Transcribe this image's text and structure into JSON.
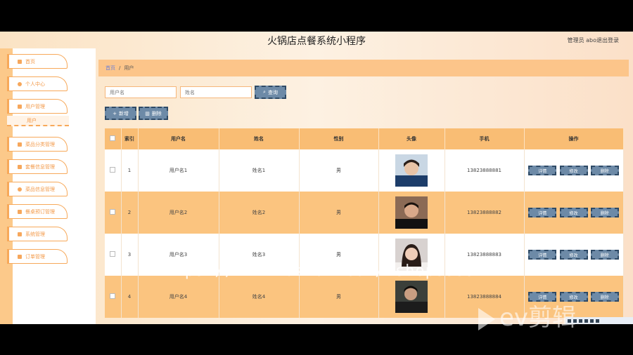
{
  "header": {
    "title": "火锅店点餐系统小程序",
    "user": "管理员 abo",
    "logout": "退出登录"
  },
  "sidebar": {
    "items": [
      {
        "label": "首页",
        "icon": "home-icon"
      },
      {
        "label": "个人中心",
        "icon": "person-icon"
      },
      {
        "label": "用户管理",
        "icon": "flag-icon"
      },
      {
        "label": "菜品分类管理",
        "icon": "flag-icon"
      },
      {
        "label": "套餐信息管理",
        "icon": "grid-icon"
      },
      {
        "label": "菜品信息管理",
        "icon": "gear-icon"
      },
      {
        "label": "餐桌预订管理",
        "icon": "flag-icon"
      },
      {
        "label": "系统管理",
        "icon": "grid-icon"
      },
      {
        "label": "订单管理",
        "icon": "grid-icon"
      }
    ],
    "subitem": "用户"
  },
  "breadcrumb": {
    "home": "首页",
    "separator": "/",
    "current": "用户"
  },
  "search": {
    "username_placeholder": "用户名",
    "name_placeholder": "姓名",
    "query_label": "查询"
  },
  "actions": {
    "add_label": "新增",
    "delete_label": "删除"
  },
  "table": {
    "headers": [
      "",
      "索引",
      "用户名",
      "姓名",
      "性别",
      "头像",
      "手机",
      "操作"
    ],
    "rows": [
      {
        "index": "1",
        "username": "用户名1",
        "name": "姓名1",
        "gender": "男",
        "phone": "13823888881"
      },
      {
        "index": "2",
        "username": "用户名2",
        "name": "姓名2",
        "gender": "男",
        "phone": "13823888882"
      },
      {
        "index": "3",
        "username": "用户名3",
        "name": "姓名3",
        "gender": "男",
        "phone": "13823888883"
      },
      {
        "index": "4",
        "username": "用户名4",
        "name": "姓名4",
        "gender": "男",
        "phone": "13823888884"
      }
    ],
    "row_actions": {
      "detail": "详情",
      "edit": "修改",
      "delete": "删除"
    }
  },
  "overlay": {
    "watermark": "https://www.huzhan.com/ishop39397",
    "logo": "ev剪辑"
  },
  "colors": {
    "accent": "#f7a95a",
    "header_row": "#f9bd74",
    "even_row": "#fbc47f",
    "button": "#6d8aa7"
  }
}
